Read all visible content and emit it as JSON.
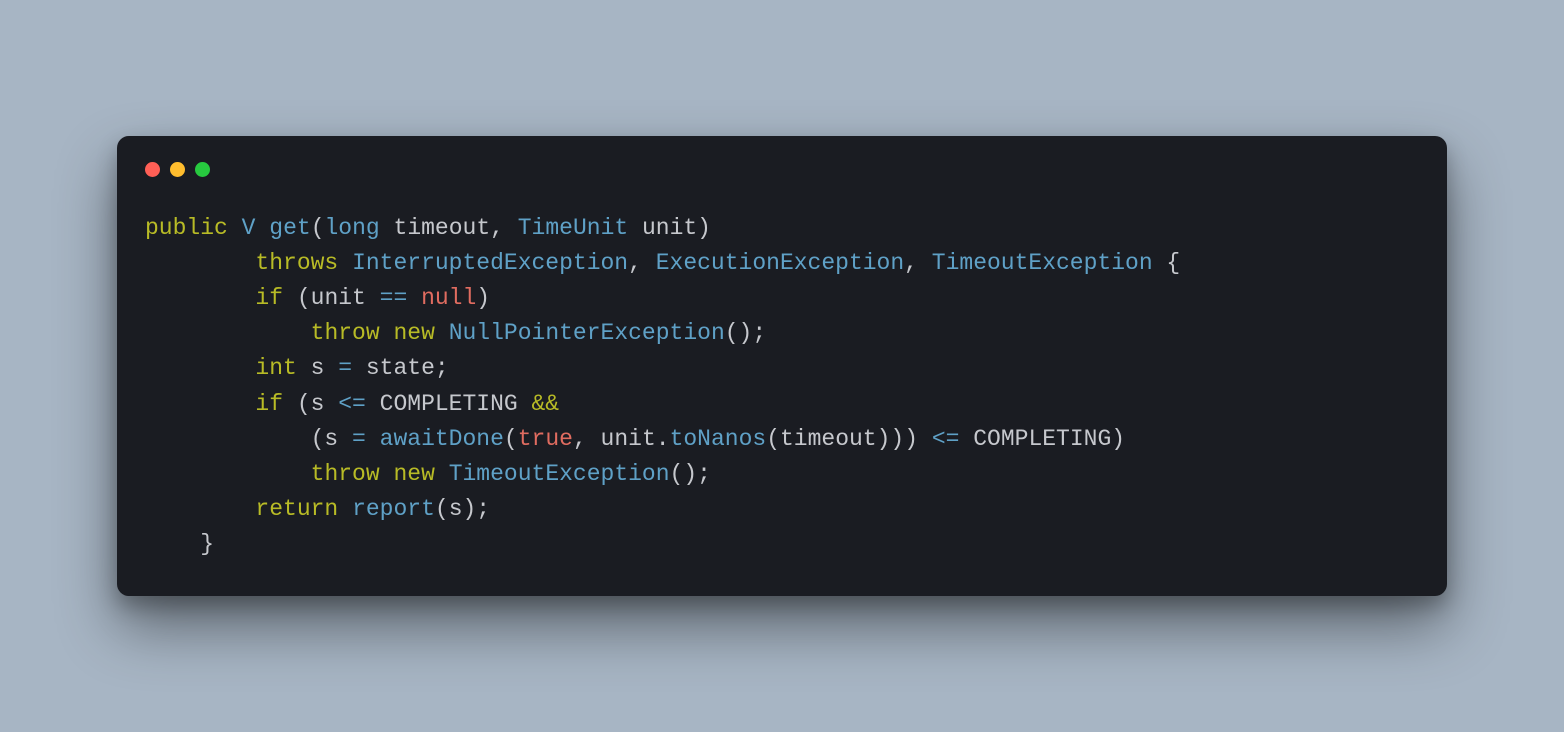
{
  "colors": {
    "background": "#a7b5c4",
    "editor_bg": "#1a1c22",
    "text": "#c6c8cd",
    "keyword": "#b8bb26",
    "type": "#5fa1c7",
    "literal": "#e06c60",
    "dot_red": "#ff5f56",
    "dot_yellow": "#ffbd2e",
    "dot_green": "#27c93f"
  },
  "code": {
    "language": "java",
    "lines": [
      [
        {
          "cls": "kw",
          "t": "public"
        },
        {
          "cls": "pun",
          "t": " "
        },
        {
          "cls": "type",
          "t": "V"
        },
        {
          "cls": "pun",
          "t": " "
        },
        {
          "cls": "call",
          "t": "get"
        },
        {
          "cls": "pun",
          "t": "("
        },
        {
          "cls": "type",
          "t": "long"
        },
        {
          "cls": "pun",
          "t": " timeout, "
        },
        {
          "cls": "type",
          "t": "TimeUnit"
        },
        {
          "cls": "pun",
          "t": " unit)"
        }
      ],
      [
        {
          "cls": "pun",
          "t": "        "
        },
        {
          "cls": "kw",
          "t": "throws"
        },
        {
          "cls": "pun",
          "t": " "
        },
        {
          "cls": "type",
          "t": "InterruptedException"
        },
        {
          "cls": "pun",
          "t": ", "
        },
        {
          "cls": "type",
          "t": "ExecutionException"
        },
        {
          "cls": "pun",
          "t": ", "
        },
        {
          "cls": "type",
          "t": "TimeoutException"
        },
        {
          "cls": "pun",
          "t": " {"
        }
      ],
      [
        {
          "cls": "pun",
          "t": "        "
        },
        {
          "cls": "kw",
          "t": "if"
        },
        {
          "cls": "pun",
          "t": " (unit "
        },
        {
          "cls": "op",
          "t": "=="
        },
        {
          "cls": "pun",
          "t": " "
        },
        {
          "cls": "lit",
          "t": "null"
        },
        {
          "cls": "pun",
          "t": ")"
        }
      ],
      [
        {
          "cls": "pun",
          "t": "            "
        },
        {
          "cls": "kw",
          "t": "throw"
        },
        {
          "cls": "pun",
          "t": " "
        },
        {
          "cls": "kw",
          "t": "new"
        },
        {
          "cls": "pun",
          "t": " "
        },
        {
          "cls": "type",
          "t": "NullPointerException"
        },
        {
          "cls": "pun",
          "t": "();"
        }
      ],
      [
        {
          "cls": "pun",
          "t": "        "
        },
        {
          "cls": "kw",
          "t": "int"
        },
        {
          "cls": "pun",
          "t": " s "
        },
        {
          "cls": "op",
          "t": "="
        },
        {
          "cls": "pun",
          "t": " state;"
        }
      ],
      [
        {
          "cls": "pun",
          "t": "        "
        },
        {
          "cls": "kw",
          "t": "if"
        },
        {
          "cls": "pun",
          "t": " (s "
        },
        {
          "cls": "op",
          "t": "<="
        },
        {
          "cls": "pun",
          "t": " COMPLETING "
        },
        {
          "cls": "and",
          "t": "&&"
        }
      ],
      [
        {
          "cls": "pun",
          "t": "            (s "
        },
        {
          "cls": "op",
          "t": "="
        },
        {
          "cls": "pun",
          "t": " "
        },
        {
          "cls": "call",
          "t": "awaitDone"
        },
        {
          "cls": "pun",
          "t": "("
        },
        {
          "cls": "lit",
          "t": "true"
        },
        {
          "cls": "pun",
          "t": ", unit."
        },
        {
          "cls": "call",
          "t": "toNanos"
        },
        {
          "cls": "pun",
          "t": "(timeout))) "
        },
        {
          "cls": "op",
          "t": "<="
        },
        {
          "cls": "pun",
          "t": " COMPLETING)"
        }
      ],
      [
        {
          "cls": "pun",
          "t": "            "
        },
        {
          "cls": "kw",
          "t": "throw"
        },
        {
          "cls": "pun",
          "t": " "
        },
        {
          "cls": "kw",
          "t": "new"
        },
        {
          "cls": "pun",
          "t": " "
        },
        {
          "cls": "type",
          "t": "TimeoutException"
        },
        {
          "cls": "pun",
          "t": "();"
        }
      ],
      [
        {
          "cls": "pun",
          "t": "        "
        },
        {
          "cls": "kw",
          "t": "return"
        },
        {
          "cls": "pun",
          "t": " "
        },
        {
          "cls": "call",
          "t": "report"
        },
        {
          "cls": "pun",
          "t": "(s);"
        }
      ],
      [
        {
          "cls": "pun",
          "t": "    }"
        }
      ]
    ]
  }
}
